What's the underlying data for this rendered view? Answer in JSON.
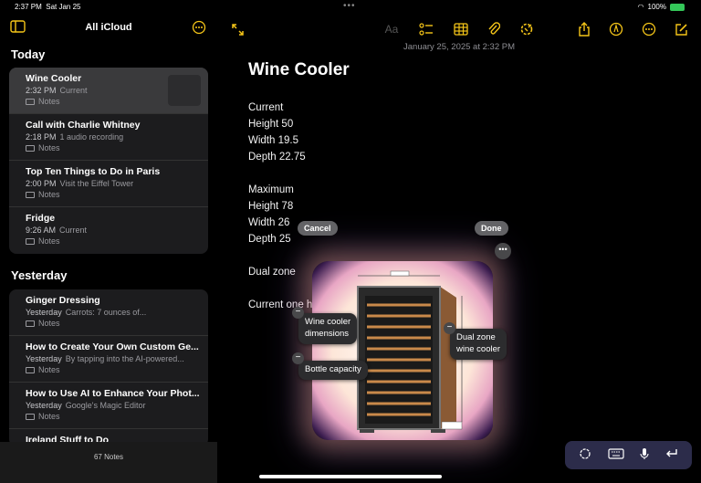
{
  "status": {
    "time": "2:37 PM",
    "date": "Sat Jan 25",
    "battery": "100%"
  },
  "sidebar": {
    "title": "All iCloud",
    "sections": [
      {
        "title": "Today",
        "notes": [
          {
            "title": "Wine Cooler",
            "date": "2:32 PM",
            "preview": "Current",
            "folder": "Notes",
            "selected": true
          },
          {
            "title": "Call with Charlie Whitney",
            "date": "2:18 PM",
            "preview": "1 audio recording",
            "folder": "Notes"
          },
          {
            "title": "Top Ten Things to Do in Paris",
            "date": "2:00 PM",
            "preview": "Visit the Eiffel Tower",
            "folder": "Notes"
          },
          {
            "title": "Fridge",
            "date": "9:26 AM",
            "preview": "Current",
            "folder": "Notes"
          }
        ]
      },
      {
        "title": "Yesterday",
        "notes": [
          {
            "title": "Ginger Dressing",
            "date": "Yesterday",
            "preview": "Carrots: 7 ounces of...",
            "folder": "Notes"
          },
          {
            "title": "How to Create Your Own Custom Ge...",
            "date": "Yesterday",
            "preview": "By tapping into the AI-powered...",
            "folder": "Notes"
          },
          {
            "title": "How to Use AI to Enhance Your Phot...",
            "date": "Yesterday",
            "preview": "Google's Magic Editor",
            "folder": "Notes"
          },
          {
            "title": "Ireland Stuff to Do",
            "date": "",
            "preview": "",
            "folder": ""
          }
        ]
      }
    ],
    "footer": "67 Notes"
  },
  "note": {
    "date": "January 25, 2025 at 2:32 PM",
    "title": "Wine Cooler",
    "lines": [
      "Current",
      "Height 50",
      "Width 19.5",
      "Depth 22.75",
      "",
      "Maximum",
      "Height 78",
      "Width 26",
      "Depth 25",
      "",
      "Dual zone",
      "",
      "Current one h"
    ]
  },
  "image_tools": {
    "cancel": "Cancel",
    "done": "Done",
    "callouts": [
      "Wine cooler\ndimensions",
      "Dual zone\nwine cooler",
      "Bottle capacity"
    ]
  },
  "icons": [
    "sidebar-toggle-icon",
    "more-icon",
    "expand-icon",
    "text-format-icon",
    "checklist-icon",
    "table-icon",
    "attachment-icon",
    "apple-intelligence-icon",
    "share-icon",
    "markup-icon",
    "compose-icon",
    "keyboard-icon",
    "mic-icon",
    "return-icon"
  ]
}
